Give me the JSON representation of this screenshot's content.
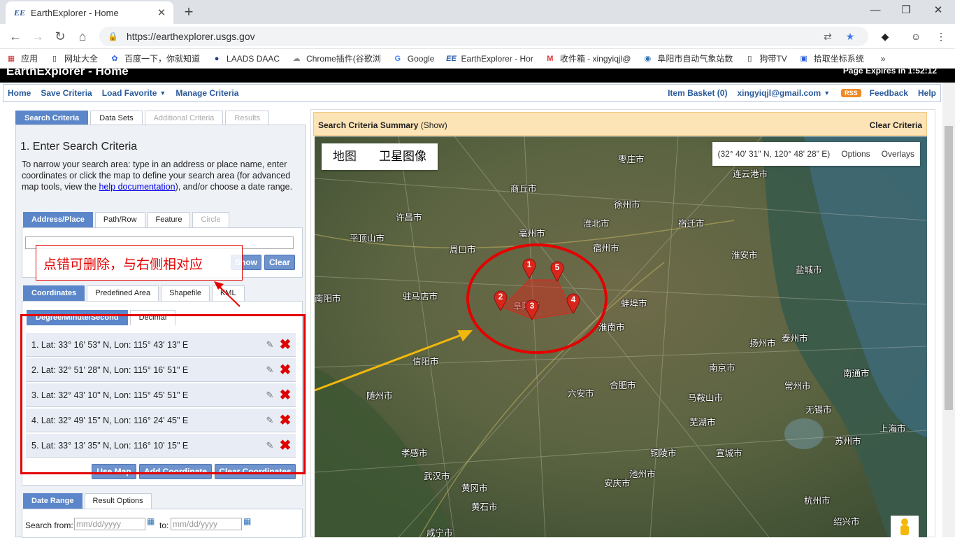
{
  "browser": {
    "tab_title": "EarthExplorer - Home",
    "tab_favicon": "EE",
    "url": "https://earthexplorer.usgs.gov",
    "bookmarks": [
      "应用",
      "网址大全",
      "百度一下，你就知道",
      "LAADS DAAC",
      "Chrome插件(谷歌浏",
      "Google",
      "EarthExplorer - Hor",
      "收件箱 - xingyiqjl@",
      "阜阳市自动气象站数",
      "狗带TV",
      "拾取坐标系统"
    ]
  },
  "header": {
    "title": "EarthExplorer - Home",
    "page_expires": "Page Expires in 1:52:12"
  },
  "menu": {
    "left": [
      "Home",
      "Save Criteria",
      "Load Favorite",
      "Manage Criteria"
    ],
    "basket": "Item Basket (0)",
    "user": "xingyiqjl@gmail.com",
    "rss": "RSS",
    "feedback": "Feedback",
    "help": "Help"
  },
  "tabs": [
    "Search Criteria",
    "Data Sets",
    "Additional Criteria",
    "Results"
  ],
  "criteria": {
    "heading": "1. Enter Search Criteria",
    "desc_pre": "To narrow your search area: type in an address or place name, enter coordinates or click the map to define your search area (for advanced map tools, view the ",
    "desc_link": "help documentation",
    "desc_post": "), and/or choose a date range.",
    "place_tabs": [
      "Address/Place",
      "Path/Row",
      "Feature",
      "Circle"
    ],
    "show": "Show",
    "clear": "Clear",
    "coord_tabs": [
      "Coordinates",
      "Predefined Area",
      "Shapefile",
      "KML"
    ],
    "format_tabs": [
      "Degree/Minute/Second",
      "Decimal"
    ],
    "coordinates": [
      "1.  Lat: 33° 16' 53\" N, Lon: 115° 43' 13\" E",
      "2.  Lat: 32° 51' 28\" N, Lon: 115° 16' 51\" E",
      "3.  Lat: 32° 43' 10\" N, Lon: 115° 45' 51\" E",
      "4.  Lat: 32° 49' 15\" N, Lon: 116° 24' 45\" E",
      "5.  Lat: 33° 13' 35\" N, Lon: 116° 10' 15\" E"
    ],
    "use_map": "Use Map",
    "add_coordinate": "Add Coordinate",
    "clear_coordinates": "Clear Coordinates",
    "date_tabs": [
      "Date Range",
      "Result Options"
    ],
    "search_from": "Search from:",
    "to": "to:",
    "date_placeholder": "mm/dd/yyyy"
  },
  "annotation": {
    "note": "点错可删除，与右侧相对应"
  },
  "summary": {
    "title": "Search Criteria Summary",
    "show": "(Show)",
    "clear": "Clear Criteria"
  },
  "map": {
    "types": [
      "地图",
      "卫星图像"
    ],
    "coords": "(32° 40' 31\" N, 120° 48' 28\" E)",
    "options": "Options",
    "overlays": "Overlays",
    "markers": [
      "1",
      "2",
      "3",
      "4",
      "5"
    ],
    "cities": [
      "枣庄市",
      "连云港市",
      "商丘市",
      "徐州市",
      "许昌市",
      "亳州市",
      "淮北市",
      "宿迁市",
      "平顶山市",
      "周口市",
      "宿州市",
      "淮安市",
      "盐城市",
      "驻马店市",
      "阜阳市",
      "蚌埠市",
      "南阳市",
      "淮南市",
      "扬州市",
      "泰州市",
      "信阳市",
      "南京市",
      "南通市",
      "随州市",
      "六安市",
      "合肥市",
      "马鞍山市",
      "常州市",
      "无锡市",
      "芜湖市",
      "孝感市",
      "铜陵市",
      "上海市",
      "苏州市",
      "宣城市",
      "武汉市",
      "池州市",
      "黄冈市",
      "安庆市",
      "杭州市",
      "黄石市",
      "咸宁市",
      "绍兴市"
    ]
  },
  "colors": {
    "accent": "#5b86c9",
    "annotation": "#e40000",
    "arrow": "#f2b80c"
  }
}
